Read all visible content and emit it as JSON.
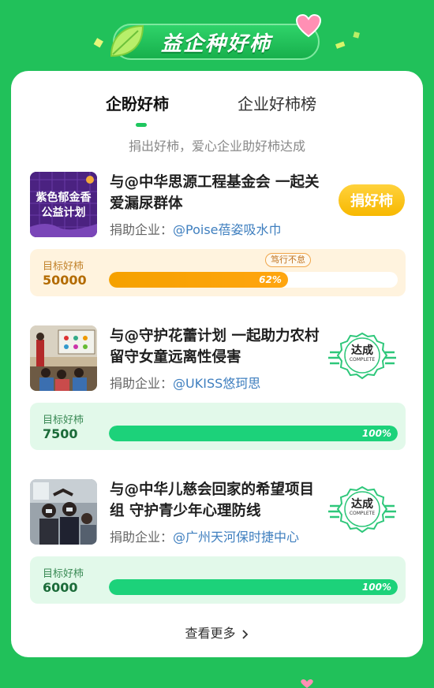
{
  "header": {
    "title": "益企种好柿"
  },
  "tabs": [
    {
      "label": "企盼好柿",
      "active": true
    },
    {
      "label": "企业好柿榜",
      "active": false
    }
  ],
  "subtitle": "捐出好柿，爱心企业助好柿达成",
  "sponsor_prefix": "捐助企业：",
  "projects": [
    {
      "thumb_text_line1": "紫色郁金香",
      "thumb_text_line2": "公益计划",
      "title": "与@中华思源工程基金会 一起关爱漏尿群体",
      "sponsor": "@Poise蓓姿吸水巾",
      "action": "捐好柿",
      "target_label": "目标好柿",
      "target": "50000",
      "progress": 62,
      "progress_text": "62%",
      "tag": "笃行不怠",
      "status": "in-progress"
    },
    {
      "title": "与@守护花蕾计划 一起助力农村留守女童远离性侵害",
      "sponsor": "@UKISS悠珂思",
      "badge": "达成",
      "badge_sub": "COMPLETE",
      "target_label": "目标好柿",
      "target": "7500",
      "progress": 100,
      "progress_text": "100%",
      "status": "complete"
    },
    {
      "title": "与@中华儿慈会回家的希望项目组 守护青少年心理防线",
      "sponsor": "@广州天河保时捷中心",
      "badge": "达成",
      "badge_sub": "COMPLETE",
      "target_label": "目标好柿",
      "target": "6000",
      "progress": 100,
      "progress_text": "100%",
      "status": "complete"
    }
  ],
  "more_label": "查看更多",
  "colors": {
    "brand_green": "#21c15a",
    "accent_orange": "#f5a100",
    "complete_green": "#1cd27a"
  },
  "icons": {
    "chevron": "chevron-right-icon",
    "leaf": "leaf-icon",
    "heart": "heart-icon"
  }
}
